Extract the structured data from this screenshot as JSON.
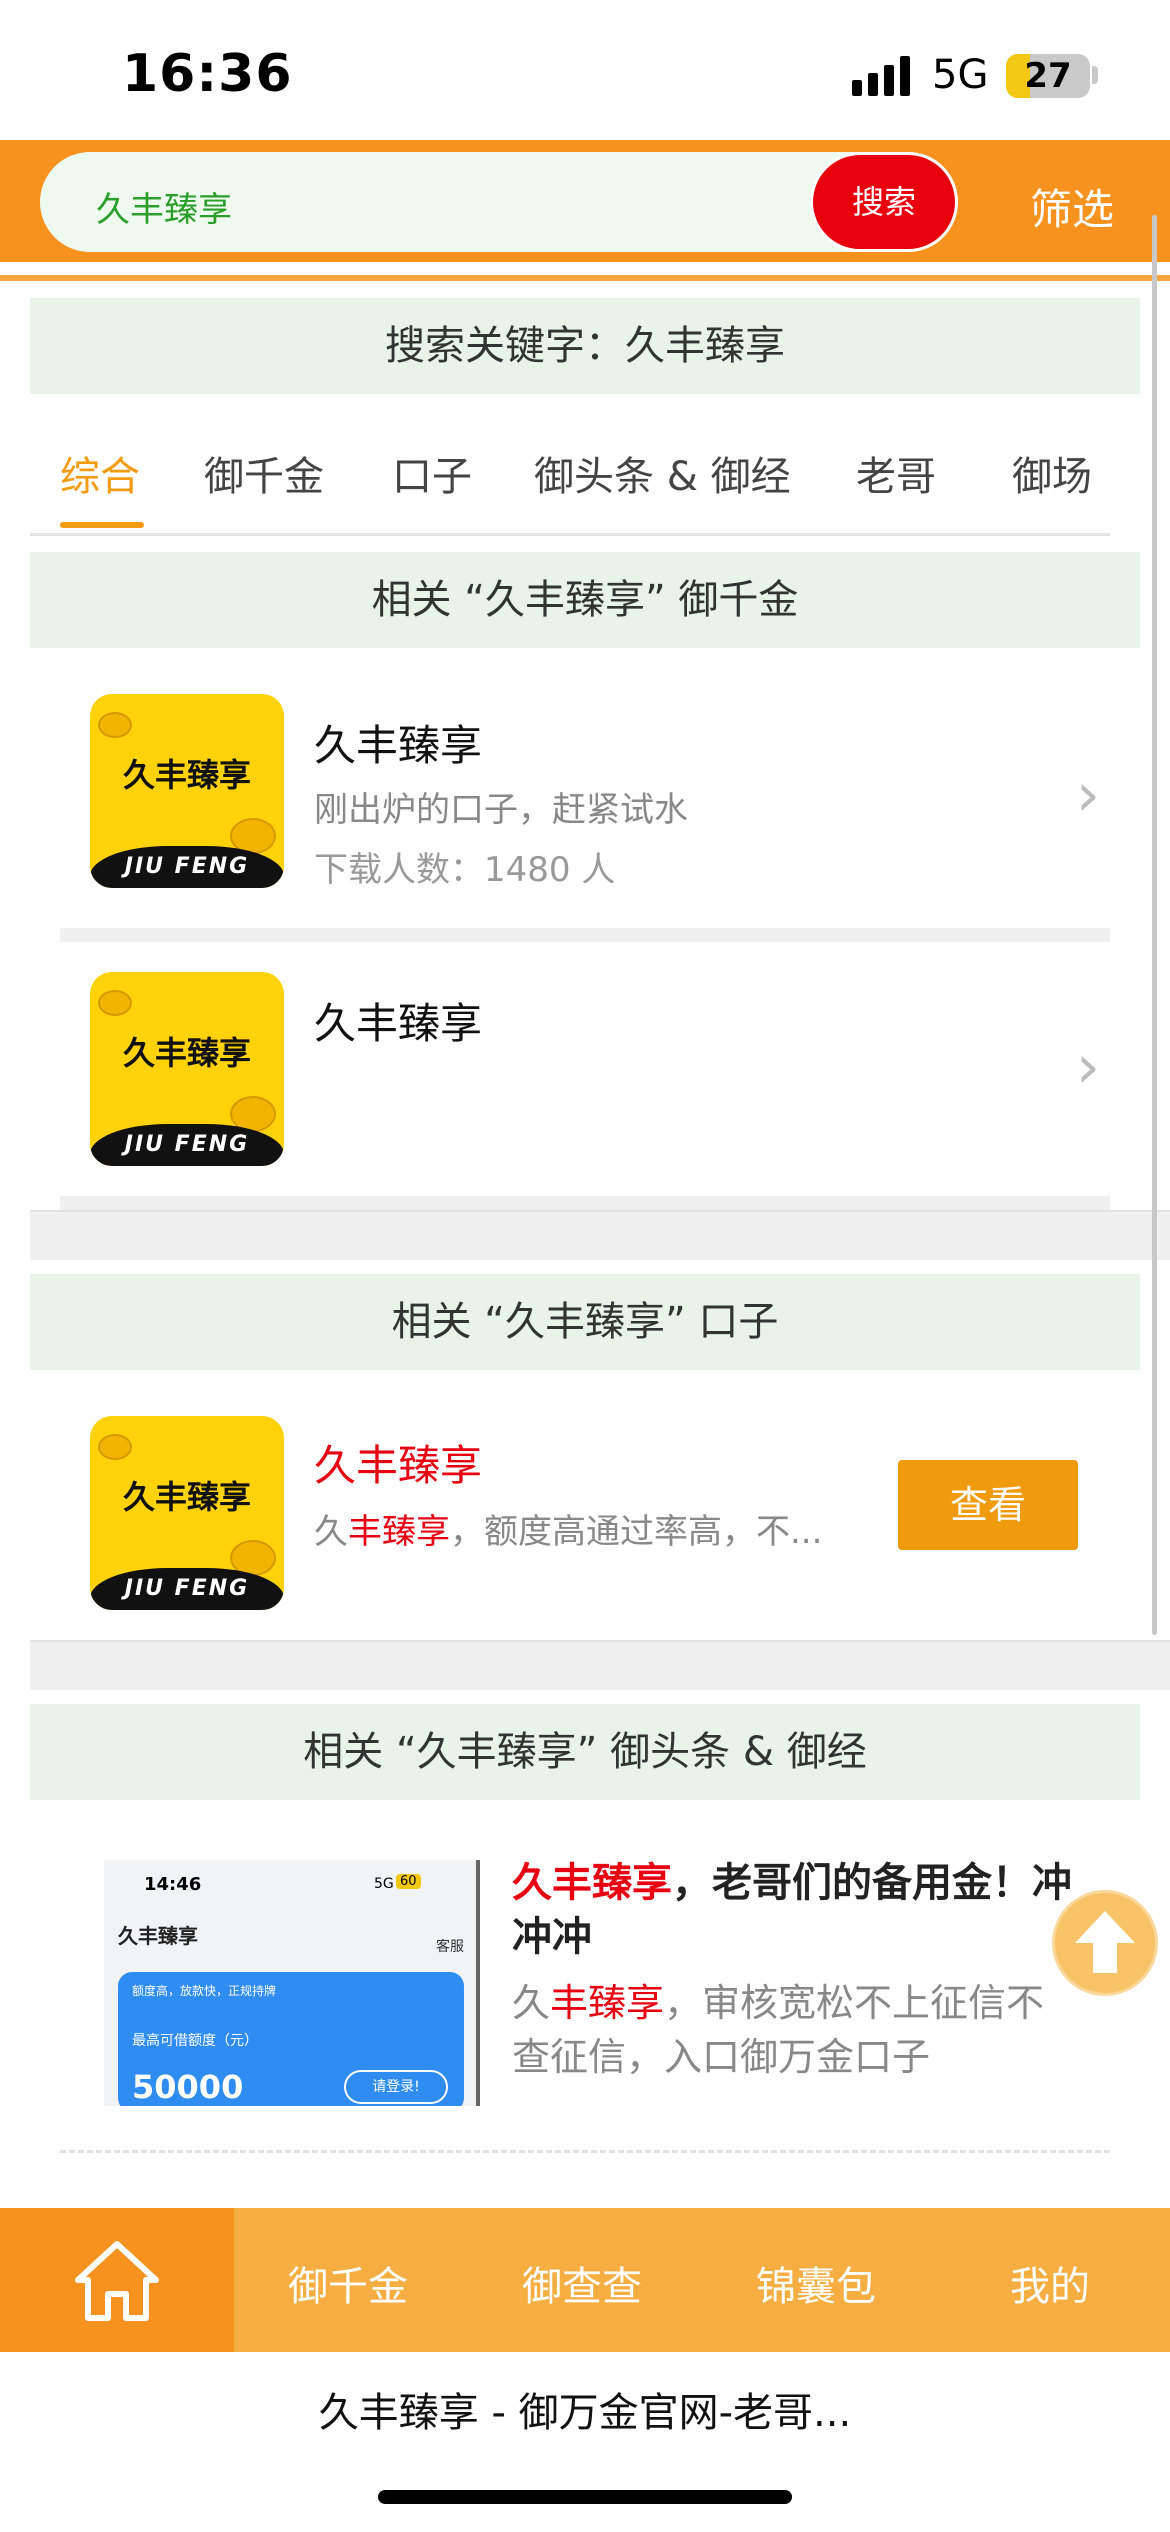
{
  "status_bar": {
    "time": "16:36",
    "network": "5G",
    "battery": "27"
  },
  "search": {
    "query": "久丰臻享",
    "button_label": "搜索",
    "filter_label": "筛选"
  },
  "keyword_banner": "搜索关键字：久丰臻享",
  "tabs": [
    "综合",
    "御千金",
    "口子",
    "御头条 & 御经",
    "老哥",
    "御场"
  ],
  "active_tab": "综合",
  "section1": {
    "title": "相关 “久丰臻享” 御千金",
    "items": [
      {
        "name": "久丰臻享",
        "desc": "刚出炉的口子，赶紧试水",
        "downloads": "下载人数：1480 人"
      },
      {
        "name": "久丰臻享"
      }
    ]
  },
  "section2": {
    "title": "相关 “久丰臻享” 口子",
    "item": {
      "name": "久丰臻享",
      "desc_prefix": "久",
      "desc_highlight": "丰臻享",
      "desc_rest": "，额度高通过率高，不...",
      "button": "查看"
    }
  },
  "section3": {
    "title": "相关 “久丰臻享” 御头条 & 御经",
    "article": {
      "title_highlight": "久丰臻享",
      "title_rest": "，老哥们的备用金！冲冲冲",
      "desc_prefix": "久",
      "desc_highlight": "丰臻享",
      "desc_rest": "，审核宽松不上征信不查征信，入口御万金口子",
      "thumb": {
        "time": "14:46",
        "net": "5G",
        "battery": "60",
        "app_name": "久丰臻享",
        "service": "客服",
        "tagline": "额度高，放款快，正规持牌",
        "limit_label": "最高可借额度（元）",
        "amount": "50000",
        "login": "请登录!"
      }
    }
  },
  "app_icon": {
    "brand": "久丰臻享",
    "band": "JIU FENG"
  },
  "bottom_nav": {
    "home_icon": "home-icon",
    "items": [
      "御千金",
      "御查查",
      "锦囊包",
      "我的"
    ]
  },
  "page_title_bar": "久丰臻享 - 御万金官网-老哥...",
  "colors": {
    "accent": "#f7921e",
    "red": "#e60012",
    "section_bg": "#e8f4ea"
  }
}
